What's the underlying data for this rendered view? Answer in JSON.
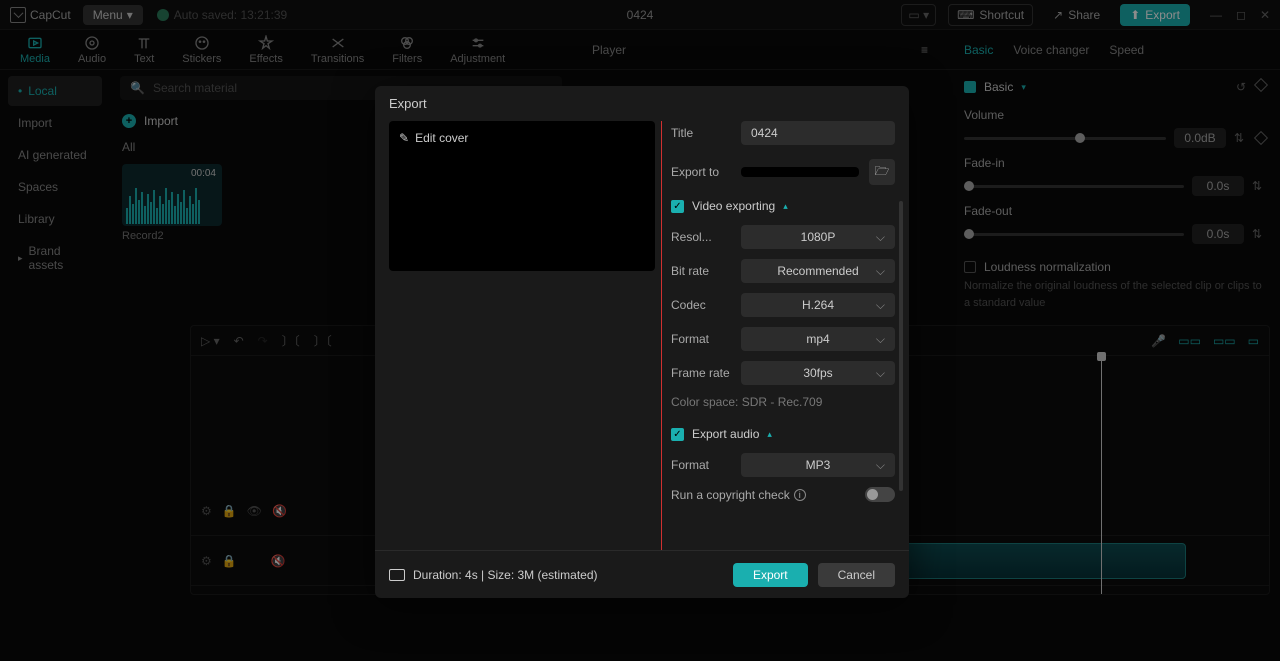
{
  "topbar": {
    "app_name": "CapCut",
    "menu_label": "Menu",
    "autosave": "Auto saved: 13:21:39",
    "project_title": "0424",
    "shortcut": "Shortcut",
    "share": "Share",
    "export": "Export"
  },
  "ribbon": {
    "media": "Media",
    "audio": "Audio",
    "text": "Text",
    "stickers": "Stickers",
    "effects": "Effects",
    "transitions": "Transitions",
    "filters": "Filters",
    "adjustment": "Adjustment"
  },
  "sidebar": {
    "local": "Local",
    "import": "Import",
    "ai_generated": "AI generated",
    "spaces": "Spaces",
    "library": "Library",
    "brand_assets": "Brand assets"
  },
  "media": {
    "search_placeholder": "Search material",
    "import": "Import",
    "all": "All",
    "clip_duration": "00:04",
    "clip_name": "Record2"
  },
  "player": {
    "label": "Player"
  },
  "props": {
    "tabs": {
      "basic": "Basic",
      "voice_changer": "Voice changer",
      "speed": "Speed"
    },
    "basic_label": "Basic",
    "volume": "Volume",
    "volume_val": "0.0dB",
    "fade_in": "Fade-in",
    "fade_in_val": "0.0s",
    "fade_out": "Fade-out",
    "fade_out_val": "0.0s",
    "loudness": "Loudness normalization",
    "loudness_desc": "Normalize the original loudness of the selected clip or clips to a standard value"
  },
  "modal": {
    "title": "Export",
    "edit_cover": "Edit cover",
    "title_label": "Title",
    "title_value": "0424",
    "export_to_label": "Export to",
    "export_to_value": "",
    "video_exporting": "Video exporting",
    "resolution_label": "Resol...",
    "resolution_value": "1080P",
    "bitrate_label": "Bit rate",
    "bitrate_value": "Recommended",
    "codec_label": "Codec",
    "codec_value": "H.264",
    "format_label": "Format",
    "format_value": "mp4",
    "framerate_label": "Frame rate",
    "framerate_value": "30fps",
    "colorspace": "Color space: SDR - Rec.709",
    "export_audio": "Export audio",
    "audio_format_label": "Format",
    "audio_format_value": "MP3",
    "copyright_label": "Run a copyright check",
    "duration_info": "Duration: 4s | Size: 3M (estimated)",
    "export_btn": "Export",
    "cancel_btn": "Cancel"
  }
}
